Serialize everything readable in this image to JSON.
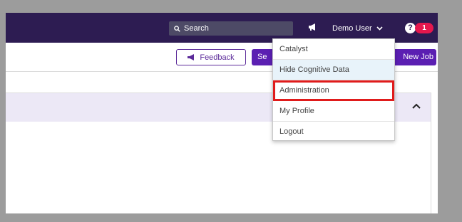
{
  "topbar": {
    "search_placeholder": "Search",
    "user_name": "Demo User",
    "help_label": "?",
    "notification_count": "1"
  },
  "toolbar": {
    "feedback_label": "Feedback",
    "partial_button_label": "Se",
    "new_job_label": "New Job"
  },
  "dropdown": {
    "items": [
      {
        "label": "Catalyst"
      },
      {
        "label": "Hide Cognitive Data"
      },
      {
        "label": "Administration"
      },
      {
        "label": "My Profile"
      },
      {
        "label": "Logout"
      }
    ]
  },
  "colors": {
    "topbar": "#2d1c52",
    "accent": "#5b1fb2",
    "badge": "#e5174d",
    "highlight_box": "#e01b1b"
  }
}
